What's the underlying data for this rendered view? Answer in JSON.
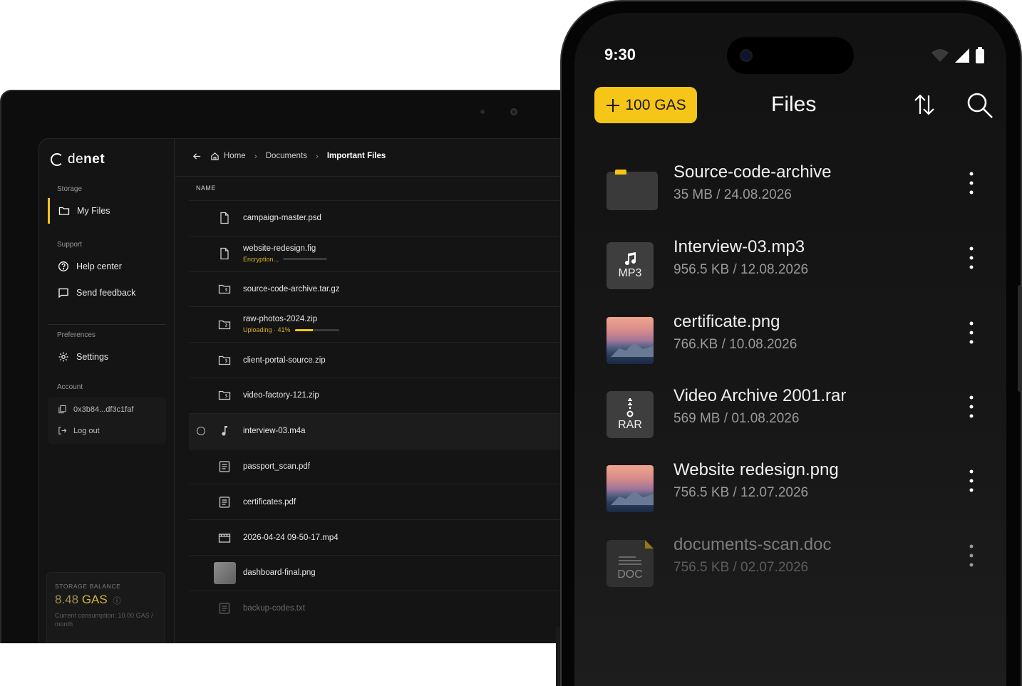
{
  "laptop": {
    "logo": {
      "prefix": "de",
      "suffix": "net"
    },
    "sidebar": {
      "storage_label": "Storage",
      "my_files": "My Files",
      "support_label": "Support",
      "help_center": "Help center",
      "send_feedback": "Send feedback",
      "preferences_label": "Preferences",
      "settings": "Settings",
      "account_label": "Account",
      "wallet": "0x3b84...df3c1faf",
      "logout": "Log out",
      "balance": {
        "label": "STORAGE BALANCE",
        "value": "8.48",
        "unit": "GAS",
        "consumption": "Current consumption: 10.00 GAS / month"
      }
    },
    "breadcrumb": [
      "Home",
      "Documents",
      "Important Files"
    ],
    "column_name": "NAME",
    "files": [
      {
        "name": "campaign-master.psd",
        "icon": "file-icon"
      },
      {
        "name": "website-redesign.fig",
        "icon": "file-icon",
        "status": "Encryption...",
        "progress": 0.0
      },
      {
        "name": "source-code-archive.tar.gz",
        "icon": "archive-icon"
      },
      {
        "name": "raw-photos-2024.zip",
        "icon": "archive-icon",
        "status": "Uploading · 41%",
        "progress": 0.41
      },
      {
        "name": "client-portal-source.zip",
        "icon": "archive-icon"
      },
      {
        "name": "video-factory-121.zip",
        "icon": "archive-icon"
      },
      {
        "name": "interview-03.m4a",
        "icon": "music-icon"
      },
      {
        "name": "passport_scan.pdf",
        "icon": "document-icon"
      },
      {
        "name": "certificates.pdf",
        "icon": "document-icon"
      },
      {
        "name": "2026-04-24 09-50-17.mp4",
        "icon": "video-icon"
      },
      {
        "name": "dashboard-final.png",
        "icon": "image-thumbnail"
      },
      {
        "name": "backup-codes.txt",
        "icon": "document-icon"
      }
    ]
  },
  "phone": {
    "time": "9:30",
    "gas_button": "100 GAS",
    "title": "Files",
    "items": [
      {
        "name": "Source-code-archive",
        "meta": "35 MB / 24.08.2026",
        "icon": "folder-icon"
      },
      {
        "name": "Interview-03.mp3",
        "meta": "956.5 KB / 12.08.2026",
        "icon": "music-icon",
        "tile": "MP3"
      },
      {
        "name": "certificate.png",
        "meta": "766.KB / 10.08.2026",
        "icon": "photo-thumbnail"
      },
      {
        "name": "Video Archive 2001.rar",
        "meta": "569 MB / 01.08.2026",
        "icon": "zip-icon",
        "tile": "RAR"
      },
      {
        "name": "Website redesign.png",
        "meta": "756.5 KB / 12.07.2026",
        "icon": "photo-thumbnail"
      },
      {
        "name": "documents-scan.doc",
        "meta": "756.5 KB / 02.07.2026",
        "icon": "doc-icon",
        "tile": "DOC"
      }
    ]
  },
  "colors": {
    "accent": "#f5c518",
    "bg": "#141414"
  }
}
